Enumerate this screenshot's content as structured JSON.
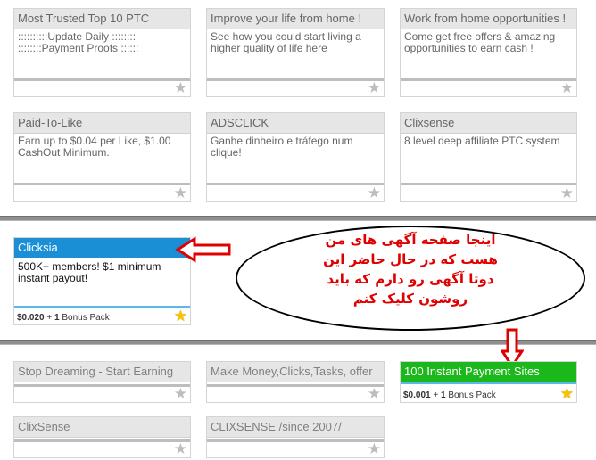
{
  "top_cards": [
    {
      "title": "Most Trusted Top 10 PTC",
      "desc": "::::::::::Update Daily ::::::::\n::::::::Payment Proofs ::::::"
    },
    {
      "title": "Improve your life from home !",
      "desc": "See how you could start living a higher quality of life here"
    },
    {
      "title": "Work from home opportunities !",
      "desc": "Come get free offers & amazing opportunities to earn cash !"
    },
    {
      "title": "Paid-To-Like",
      "desc": "Earn up to $0.04 per Like, $1.00 CashOut Minimum."
    },
    {
      "title": "ADSCLICK",
      "desc": "Ganhe dinheiro e tráfego num clique!"
    },
    {
      "title": "Clixsense",
      "desc": "8 level deep affiliate PTC system"
    }
  ],
  "featured": {
    "title": "Clicksia",
    "desc": "500K+ members! $1 minimum instant payout!",
    "price": "$0.020",
    "sep": "+",
    "count": "1",
    "pack_label": "Bonus Pack",
    "accent": "#1a8fd6"
  },
  "bottom_cards": [
    {
      "title": "Stop Dreaming - Start Earning"
    },
    {
      "title": "Make Money,Clicks,Tasks, offer"
    },
    {
      "title": "ClixSense"
    },
    {
      "title": "CLIXSENSE /since 2007/"
    }
  ],
  "green_card": {
    "title": "100 Instant Payment Sites",
    "price": "$0.001",
    "sep": "+",
    "count": "1",
    "pack_label": "Bonus Pack",
    "accent": "#1bb81b"
  },
  "annotation": {
    "lines": [
      "اینجا صفحه آگهی های من",
      "هست که در حال حاضر این",
      "دوتا آگهی رو دارم که باید",
      "روشون کلیک کنم"
    ],
    "color": "#e00000"
  },
  "icons": {
    "star": "star-icon",
    "arrow_left": "left-arrow-icon",
    "arrow_down": "down-arrow-icon"
  }
}
